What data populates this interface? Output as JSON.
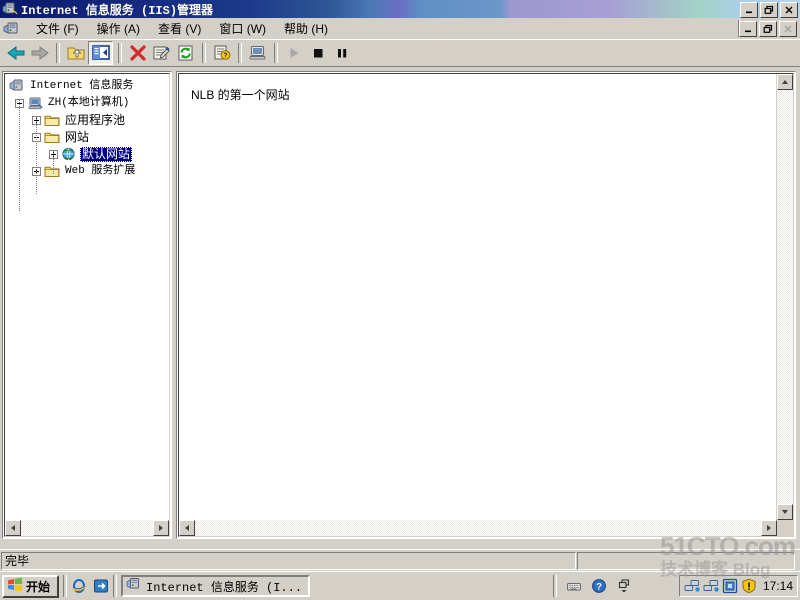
{
  "window": {
    "title": "Internet 信息服务 (IIS)管理器",
    "icon": "iis-server-icon",
    "controls": {
      "minimize": "_",
      "restore": "❐",
      "close": "✕"
    }
  },
  "menubar": {
    "system_icon": "mdi-system-icon",
    "items": [
      {
        "label": "文件 (F)",
        "name": "menu-file"
      },
      {
        "label": "操作 (A)",
        "name": "menu-action"
      },
      {
        "label": "查看 (V)",
        "name": "menu-view"
      },
      {
        "label": "窗口 (W)",
        "name": "menu-window"
      },
      {
        "label": "帮助 (H)",
        "name": "menu-help"
      }
    ],
    "mdi_controls": {
      "minimize": "_",
      "restore": "❐",
      "close": "✕"
    }
  },
  "toolbar": {
    "buttons": [
      {
        "name": "back-icon",
        "label": "后退",
        "state": "enabled"
      },
      {
        "name": "forward-icon",
        "label": "前进",
        "state": "disabled"
      },
      {
        "name": "up-folder-icon",
        "label": "向上一级",
        "state": "enabled"
      },
      {
        "name": "show-tree-icon",
        "label": "显示/隐藏控制台树",
        "state": "pressed"
      },
      {
        "name": "delete-icon",
        "label": "删除",
        "state": "enabled"
      },
      {
        "name": "properties-icon",
        "label": "属性",
        "state": "enabled"
      },
      {
        "name": "refresh-icon",
        "label": "刷新",
        "state": "enabled"
      },
      {
        "name": "help-icon",
        "label": "帮助",
        "state": "enabled"
      },
      {
        "name": "computer-icon",
        "label": "连接计算机",
        "state": "enabled"
      },
      {
        "name": "play-icon",
        "label": "启动",
        "state": "disabled"
      },
      {
        "name": "stop-icon",
        "label": "停止",
        "state": "enabled"
      },
      {
        "name": "pause-icon",
        "label": "暂停",
        "state": "enabled"
      }
    ]
  },
  "tree": {
    "nodes": [
      {
        "label": "Internet 信息服务",
        "icon": "iis-root-icon",
        "level": 0,
        "expander": "none",
        "selected": false,
        "name": "tree-node-iis-root"
      },
      {
        "label": "ZH(本地计算机)",
        "icon": "computer-icon",
        "level": 1,
        "expander": "minus",
        "selected": false,
        "name": "tree-node-local-computer"
      },
      {
        "label": "应用程序池",
        "icon": "folder-icon",
        "level": 2,
        "expander": "plus",
        "selected": false,
        "name": "tree-node-app-pools"
      },
      {
        "label": "网站",
        "icon": "folder-icon",
        "level": 2,
        "expander": "minus",
        "selected": false,
        "name": "tree-node-websites"
      },
      {
        "label": "默认网站",
        "icon": "globe-icon",
        "level": 3,
        "expander": "plus",
        "selected": true,
        "name": "tree-node-default-website"
      },
      {
        "label": "Web 服务扩展",
        "icon": "folder-icon",
        "level": 2,
        "expander": "plus",
        "selected": false,
        "name": "tree-node-web-service-extensions"
      }
    ]
  },
  "right_pane": {
    "content_text": "NLB 的第一个网站"
  },
  "statusbar": {
    "left_text": "完毕",
    "right_text": ""
  },
  "taskbar": {
    "start_label": "开始",
    "quick_launch": [
      {
        "name": "internet-explorer-icon",
        "label": "Internet Explorer"
      },
      {
        "name": "show-desktop-icon",
        "label": "显示桌面"
      }
    ],
    "tasks": [
      {
        "name": "taskbar-button-iis",
        "label": "Internet 信息服务 (I...",
        "icon": "iis-server-icon"
      }
    ],
    "tray_misc": [
      {
        "name": "keyboard-layout-icon",
        "label": "输入法"
      },
      {
        "name": "help-question-icon",
        "label": "帮助"
      },
      {
        "name": "window-list-icon",
        "label": "窗口列表"
      }
    ],
    "tray_icons": [
      {
        "name": "network-connection-icon",
        "label": "本地连接"
      },
      {
        "name": "network-connection-2-icon",
        "label": "本地连接 2"
      },
      {
        "name": "network-bridge-icon",
        "label": "网桥"
      },
      {
        "name": "security-warning-icon",
        "label": "安全警报"
      }
    ],
    "clock": "17:14"
  },
  "watermark": {
    "main": "51CTO.com",
    "sub": "技术博客 Blog"
  },
  "colors": {
    "title_start": "#0a1a6e",
    "title_end": "#b3d4ee",
    "selection": "#000080",
    "face": "#d4d0c8",
    "pane": "#ffffff"
  }
}
